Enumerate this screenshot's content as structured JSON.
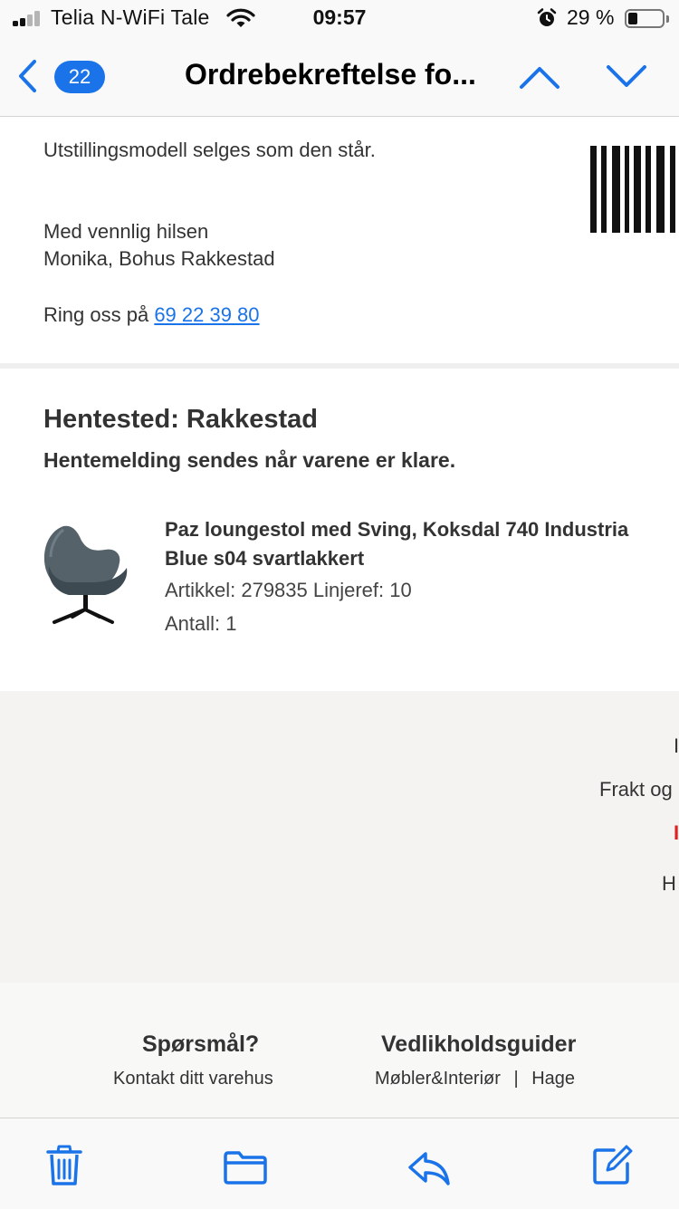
{
  "status_bar": {
    "carrier": "Telia N-WiFi Tale",
    "time": "09:57",
    "battery_percent": "29 %",
    "battery_level": 0.29,
    "signal_bars": 2,
    "icons": [
      "signal-icon",
      "wifi-icon",
      "alarm-icon",
      "battery-icon"
    ]
  },
  "nav": {
    "unread_count": "22",
    "title": "Ordrebekreftelse fo...",
    "icons": [
      "back-chevron-icon",
      "previous-message-icon",
      "next-message-icon"
    ]
  },
  "message": {
    "intro": "Utstillingsmodell selges som den står.",
    "greeting": "Med vennlig hilsen",
    "signature": "Monika, Bohus Rakkestad",
    "call_prefix": "Ring oss på",
    "phone": "69 22 39 80",
    "pickup_title": "Hentested: Rakkestad",
    "pickup_note": "Hentemelding sendes når varene er klare.",
    "product": {
      "name_line1": "Paz loungestol med Sving, Koksdal 740 Industria",
      "name_line2": "Blue s04 svartlakkert",
      "article": "Artikkel: 279835 Linjeref: 10",
      "quantity": "Antall: 1",
      "image_icon": "lounge-chair-image"
    },
    "summary": {
      "row1": "I",
      "row2": "Frakt og",
      "row3": "I",
      "row4": "H"
    },
    "footer": {
      "questions_heading": "Spørsmål?",
      "questions_link": "Kontakt ditt varehus",
      "guides_heading": "Vedlikholdsguider",
      "guide_furniture": "Møbler&Interiør",
      "guide_separator": "|",
      "guide_garden": "Hage"
    }
  },
  "toolbar": {
    "icons": [
      "trash-icon",
      "folder-icon",
      "reply-icon",
      "compose-icon"
    ]
  },
  "colors": {
    "accent": "#1a73e8",
    "link": "#1a73e8",
    "sale_red": "#e02020",
    "summary_bg": "#f4f3f2"
  }
}
